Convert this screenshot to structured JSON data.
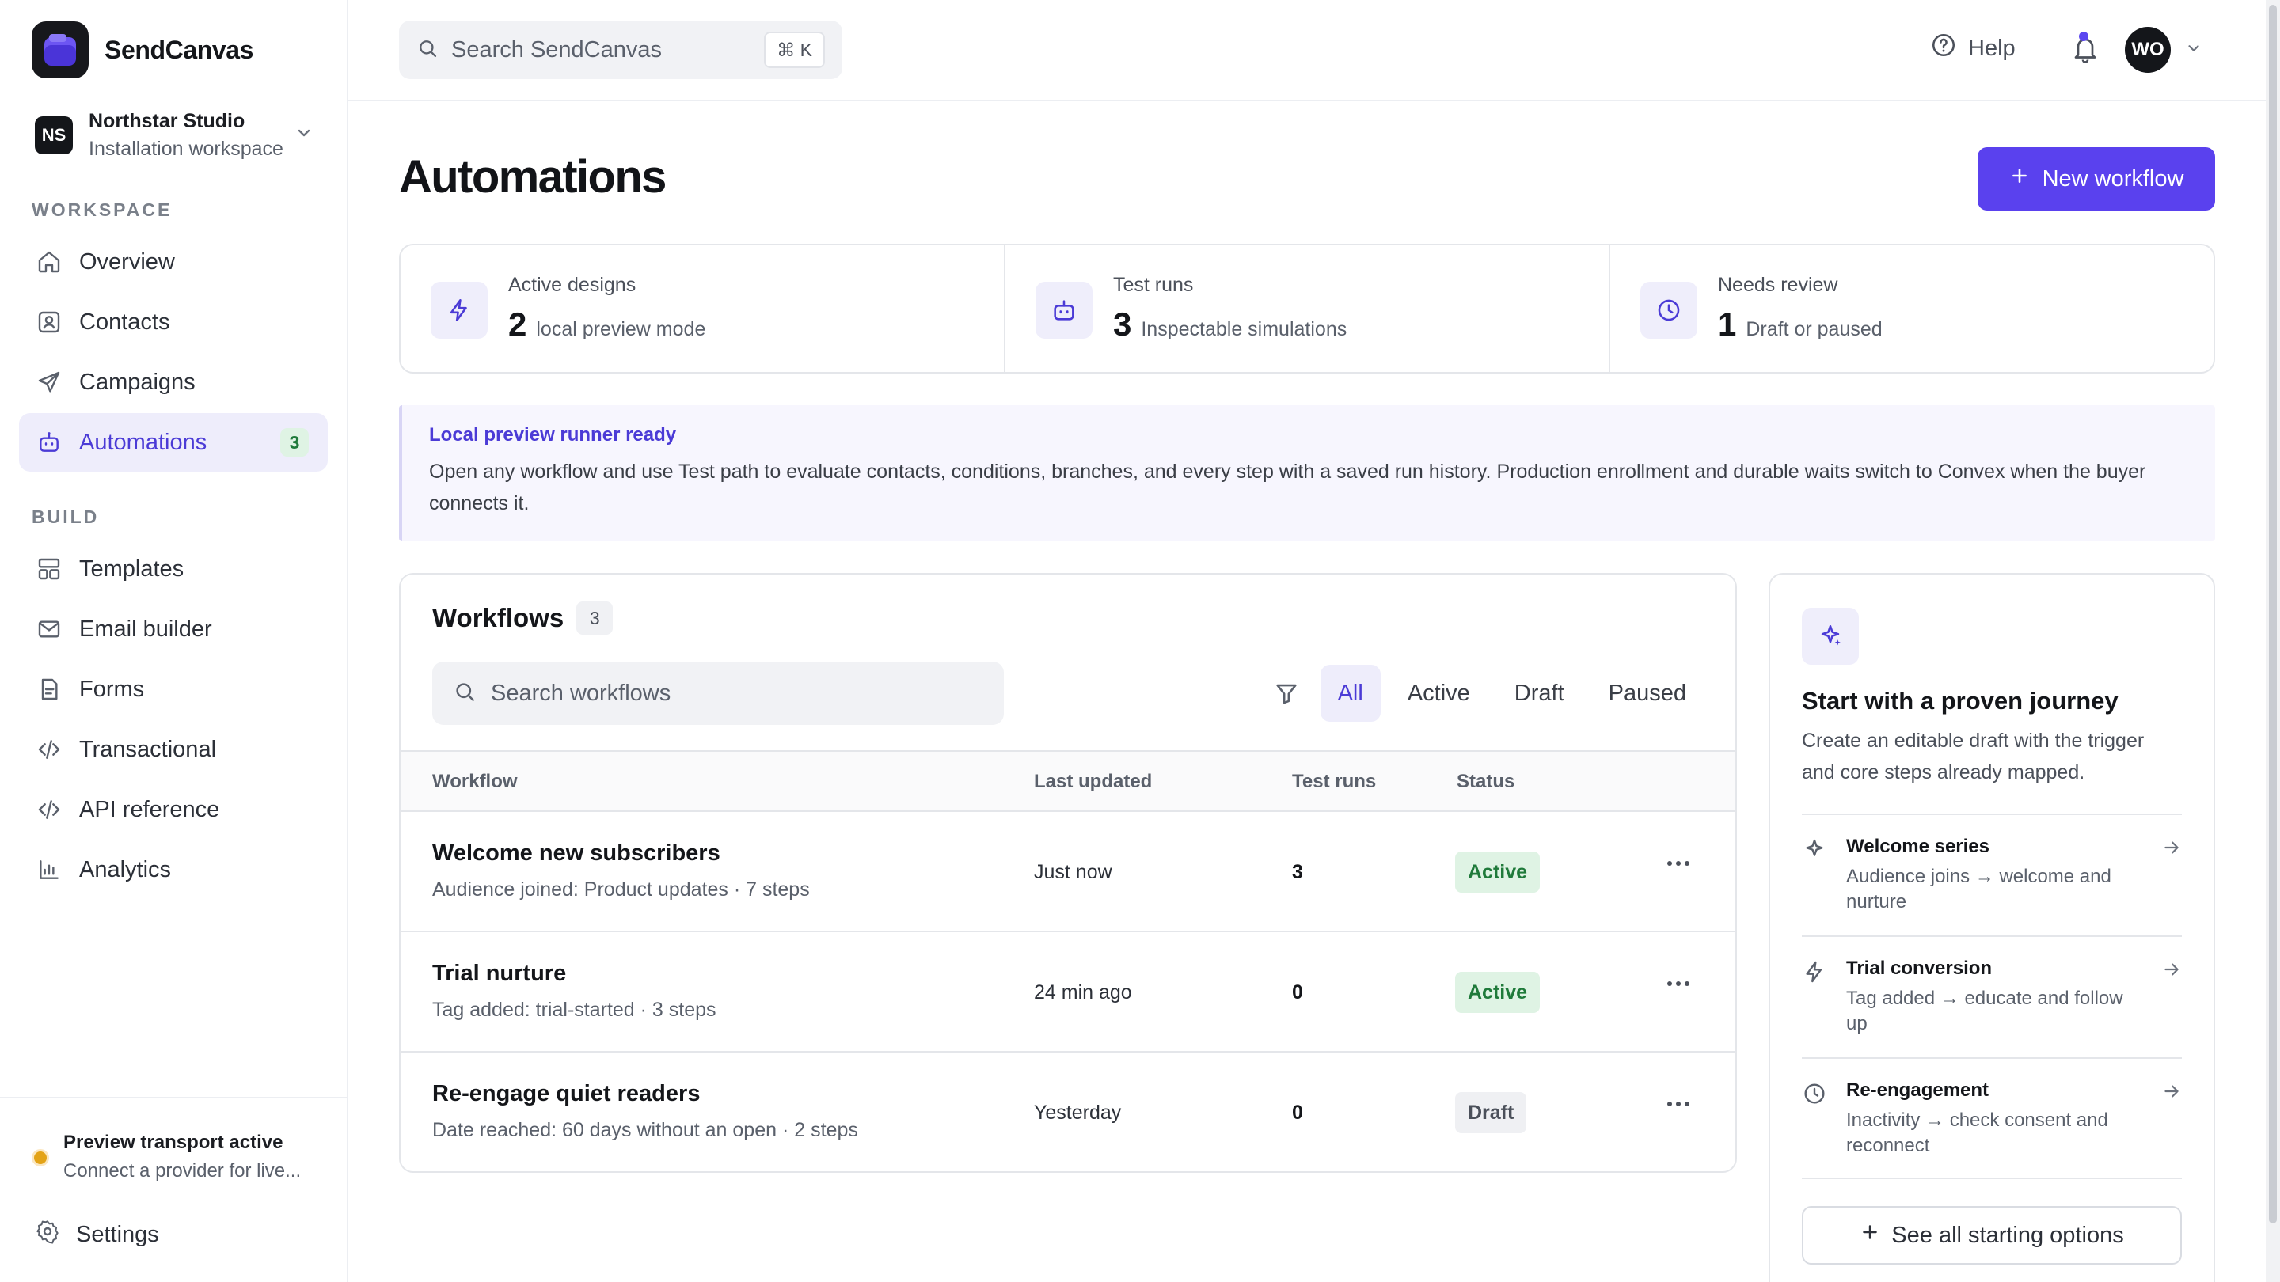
{
  "brand": {
    "name": "SendCanvas"
  },
  "workspace": {
    "initials": "NS",
    "name": "Northstar Studio",
    "subtitle": "Installation workspace"
  },
  "nav": {
    "section_workspace": "WORKSPACE",
    "section_build": "BUILD",
    "items": [
      {
        "label": "Overview",
        "icon": "home-icon"
      },
      {
        "label": "Contacts",
        "icon": "contacts-icon"
      },
      {
        "label": "Campaigns",
        "icon": "send-icon"
      },
      {
        "label": "Automations",
        "icon": "robot-icon",
        "badge": "3",
        "active": true
      },
      {
        "label": "Templates",
        "icon": "layout-icon"
      },
      {
        "label": "Email builder",
        "icon": "mail-icon"
      },
      {
        "label": "Forms",
        "icon": "form-icon"
      },
      {
        "label": "Transactional",
        "icon": "code-icon"
      },
      {
        "label": "API reference",
        "icon": "code-icon"
      },
      {
        "label": "Analytics",
        "icon": "chart-icon"
      }
    ]
  },
  "transport": {
    "title": "Preview transport active",
    "subtitle": "Connect a provider for live..."
  },
  "settings": {
    "label": "Settings"
  },
  "topbar": {
    "search_placeholder": "Search SendCanvas",
    "shortcut": "⌘ K",
    "help": "Help",
    "user_initials": "WO"
  },
  "page": {
    "title": "Automations",
    "new_button": "New workflow"
  },
  "stats": [
    {
      "label": "Active designs",
      "value": "2",
      "note": "local preview mode",
      "icon": "bolt-icon"
    },
    {
      "label": "Test runs",
      "value": "3",
      "note": "Inspectable simulations",
      "icon": "robot-icon"
    },
    {
      "label": "Needs review",
      "value": "1",
      "note": "Draft or paused",
      "icon": "clock-icon"
    }
  ],
  "notice": {
    "title": "Local preview runner ready",
    "body": "Open any workflow and use Test path to evaluate contacts, conditions, branches, and every step with a saved run history. Production enrollment and durable waits switch to Convex when the buyer connects it."
  },
  "workflows": {
    "title": "Workflows",
    "count": "3",
    "search_placeholder": "Search workflows",
    "filters": [
      "All",
      "Active",
      "Draft",
      "Paused"
    ],
    "active_filter": "All",
    "columns": {
      "workflow": "Workflow",
      "updated": "Last updated",
      "runs": "Test runs",
      "status": "Status"
    },
    "rows": [
      {
        "name": "Welcome new subscribers",
        "desc": "Audience joined: Product updates · 7 steps",
        "updated": "Just now",
        "runs": "3",
        "status": "Active"
      },
      {
        "name": "Trial nurture",
        "desc": "Tag added: trial-started · 3 steps",
        "updated": "24 min ago",
        "runs": "0",
        "status": "Active"
      },
      {
        "name": "Re-engage quiet readers",
        "desc": "Date reached: 60 days without an open · 2 steps",
        "updated": "Yesterday",
        "runs": "0",
        "status": "Draft"
      }
    ]
  },
  "journey": {
    "title": "Start with a proven journey",
    "subtitle": "Create an editable draft with the trigger and core steps already mapped.",
    "items": [
      {
        "name": "Welcome series",
        "desc": "Audience joins → welcome and nurture",
        "icon": "sparkle-icon"
      },
      {
        "name": "Trial conversion",
        "desc": "Tag added → educate and follow up",
        "icon": "bolt-icon"
      },
      {
        "name": "Re-engagement",
        "desc": "Inactivity → check consent and reconnect",
        "icon": "clock-icon"
      }
    ],
    "button": "See all starting options"
  },
  "colors": {
    "accent": "#5a41ee",
    "accent_soft": "#eeedfb",
    "success": "#1f7a3a",
    "warning": "#e3a317"
  }
}
